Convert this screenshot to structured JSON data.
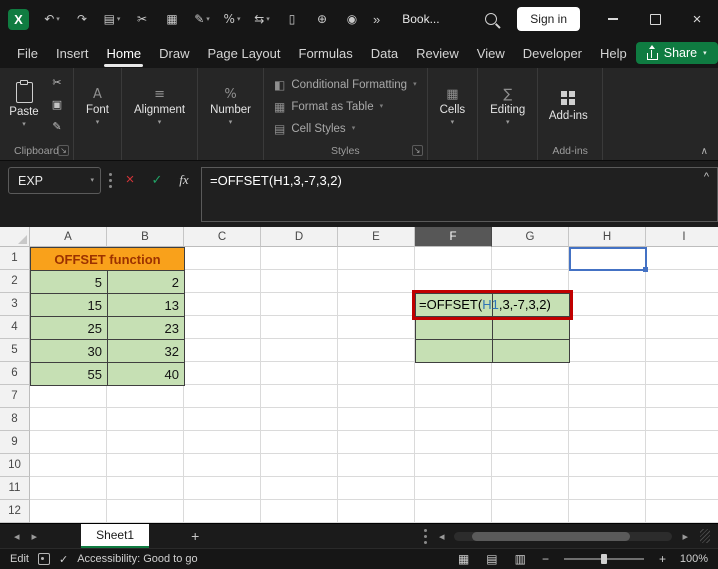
{
  "colors": {
    "excel_green": "#107C41",
    "share_green": "#0F7B41",
    "orange_fill": "#F9A11B",
    "orange_text": "#9C3200",
    "green_fill": "#C6E0B4",
    "red_border": "#C00000",
    "reference_blue": "#4472C4",
    "reference_text_blue": "#2E75B6",
    "selected_header_gray": "#575757"
  },
  "icon_glyphs": {
    "caret_down": "▾",
    "overflow": "»",
    "tab_prev": "◂",
    "tab_next": "▸",
    "scroll_left": "◂",
    "scroll_right": "▸",
    "view_normal": "▦",
    "view_layout": "▤",
    "view_break": "▥",
    "zoom_out": "−",
    "zoom_in": "+",
    "launcher": "↘",
    "collapse_ribbon": "∧",
    "window_close": "×",
    "accessibility_check": "✓"
  },
  "titlebar": {
    "doc_title": "Book...",
    "sign_in": "Sign in",
    "qat": [
      {
        "name": "undo",
        "glyph": "↶",
        "dropdown": true
      },
      {
        "name": "redo",
        "glyph": "↷",
        "dropdown": false
      },
      {
        "name": "clipboard-history",
        "glyph": "▤",
        "dropdown": true
      },
      {
        "name": "cut",
        "glyph": "✂",
        "dropdown": false
      },
      {
        "name": "copy-picture",
        "glyph": "▦",
        "dropdown": false
      },
      {
        "name": "format-painter",
        "glyph": "✎",
        "dropdown": true
      },
      {
        "name": "percent-style",
        "glyph": "%",
        "dropdown": true
      },
      {
        "name": "switch-windows",
        "glyph": "⇆",
        "dropdown": true
      },
      {
        "name": "new-document",
        "glyph": "▯",
        "dropdown": false
      },
      {
        "name": "insert-object",
        "glyph": "⊕",
        "dropdown": false
      },
      {
        "name": "camera",
        "glyph": "◉",
        "dropdown": false
      }
    ]
  },
  "menubar": {
    "items": [
      "File",
      "Insert",
      "Home",
      "Draw",
      "Page Layout",
      "Formulas",
      "Data",
      "Review",
      "View",
      "Developer",
      "Help"
    ],
    "active": "Home",
    "share": "Share"
  },
  "ribbon": {
    "paste": "Paste",
    "clipboard_small": [
      {
        "name": "cut",
        "glyph": "✂"
      },
      {
        "name": "copy",
        "glyph": "▣"
      },
      {
        "name": "format-painter",
        "glyph": "✎"
      }
    ],
    "collapsed_groups": [
      {
        "label": "Font",
        "glyph": "A"
      },
      {
        "label": "Alignment",
        "glyph": "≡"
      },
      {
        "label": "Number",
        "glyph": "%"
      },
      {
        "label": "Cells",
        "glyph": "▦"
      },
      {
        "label": "Editing",
        "glyph": "∑"
      }
    ],
    "styles": [
      {
        "label": "Conditional Formatting",
        "glyph": "◧"
      },
      {
        "label": "Format as Table",
        "glyph": "▦"
      },
      {
        "label": "Cell Styles",
        "glyph": "▤"
      }
    ],
    "addins": "Add-ins",
    "group_labels": [
      "Clipboard",
      "Styles",
      "Add-ins"
    ]
  },
  "formula_bar": {
    "name_box": "EXP",
    "cancel_glyph": "×",
    "enter_glyph": "✓",
    "fx_label": "fx",
    "formula_full": "=OFFSET(H1,3,-7,3,2)",
    "collapse_glyph": "^"
  },
  "grid": {
    "columns": [
      "A",
      "B",
      "C",
      "D",
      "E",
      "F",
      "G",
      "H",
      "I"
    ],
    "selected_column": "F",
    "row_count": 12,
    "title_cell": {
      "ref": "A1",
      "span": 2,
      "text": "OFFSET function"
    },
    "data_cells": [
      {
        "ref": "A2",
        "value": "5"
      },
      {
        "ref": "B2",
        "value": "2"
      },
      {
        "ref": "A3",
        "value": "15"
      },
      {
        "ref": "B3",
        "value": "13"
      },
      {
        "ref": "A4",
        "value": "25"
      },
      {
        "ref": "B4",
        "value": "23"
      },
      {
        "ref": "A5",
        "value": "30"
      },
      {
        "ref": "B5",
        "value": "32"
      },
      {
        "ref": "A6",
        "value": "55"
      },
      {
        "ref": "B6",
        "value": "40"
      }
    ],
    "green_range": "F3:G5",
    "red_border_range": "F3:G3",
    "in_cell_formula": {
      "cell": "F3",
      "prefix": "=OFFSET(",
      "ref": "H1",
      "suffix": ",3,-7,3,2)"
    },
    "reference_cell": "H1"
  },
  "sheet_tabs": {
    "tabs": [
      "Sheet1"
    ],
    "active": "Sheet1",
    "add_label": "+"
  },
  "status_bar": {
    "mode": "Edit",
    "accessibility": "Accessibility: Good to go",
    "zoom_label": "100%"
  }
}
